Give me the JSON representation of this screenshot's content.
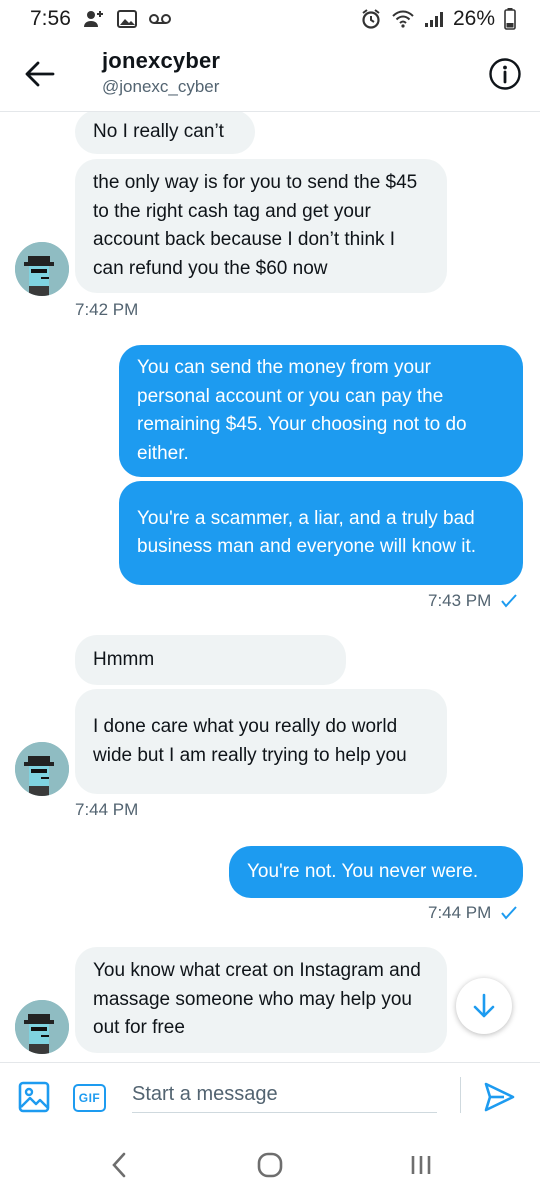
{
  "status_bar": {
    "time": "7:56",
    "battery": "26%",
    "icons": [
      "person-add-icon",
      "image-icon",
      "voicemail-icon",
      "alarm-icon",
      "wifi-icon",
      "signal-icon",
      "battery-icon"
    ]
  },
  "header": {
    "name": "jonexcyber",
    "handle": "@jonexc_cyber",
    "back_icon": "arrow-left-icon",
    "info_icon": "info-icon"
  },
  "messages": [
    {
      "direction": "in",
      "text": "No I really can’t"
    },
    {
      "direction": "in",
      "text": "the only way is for you to send the $45 to the right cash tag and get your account back because I don’t think I can refund you the $60 now"
    },
    {
      "time": "7:42 PM"
    },
    {
      "direction": "out",
      "text": "You can send the money from your personal account or you can pay the remaining $45. Your choosing not to do either."
    },
    {
      "direction": "out",
      "text": "You're a scammer, a liar, and a truly bad business man and everyone will know it."
    },
    {
      "time": "7:43 PM",
      "read": true
    },
    {
      "direction": "in",
      "text": "Hmmm"
    },
    {
      "direction": "in",
      "text": "I done care what you really do world wide but I am really trying to help you"
    },
    {
      "time": "7:44 PM"
    },
    {
      "direction": "out",
      "text": "You're not. You never were."
    },
    {
      "time": "7:44 PM",
      "read": true
    },
    {
      "direction": "in",
      "text": "You know what creat on Instagram and massage someone who may help you out for free"
    }
  ],
  "composer": {
    "placeholder": "Start a message",
    "gif_label": "GIF"
  },
  "colors": {
    "accent": "#1d9bf0",
    "incoming_bubble": "#eff3f4",
    "text_secondary": "#536471"
  }
}
